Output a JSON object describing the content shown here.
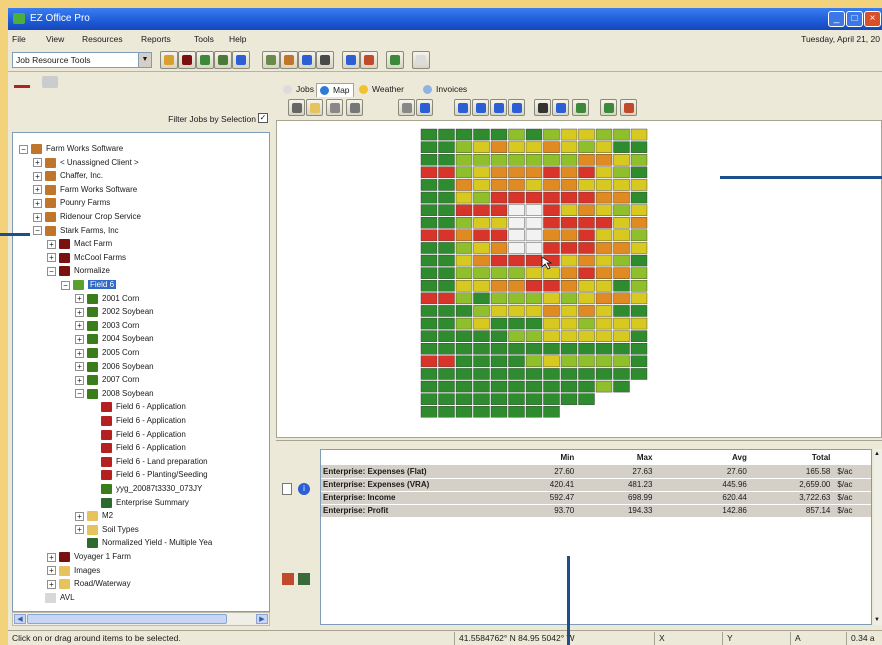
{
  "window": {
    "title": "EZ Office Pro"
  },
  "menu": {
    "items": [
      "File",
      "View",
      "Resources",
      "Reports",
      "Tools",
      "Help"
    ],
    "date": "Tuesday, April 21, 20"
  },
  "toolbar": {
    "combo_value": "Job Resource Tools"
  },
  "left": {
    "filter_label": "Filter Jobs by Selection",
    "filter_checked": "✓",
    "tree": [
      {
        "label": "Farm Works Software",
        "depth": 0,
        "pm": "−",
        "icon": "#c0762a"
      },
      {
        "label": "< Unassigned Client >",
        "depth": 1,
        "pm": "+",
        "icon": "#c0762a"
      },
      {
        "label": "Chaffer, Inc.",
        "depth": 1,
        "pm": "+",
        "icon": "#c0762a"
      },
      {
        "label": "Farm Works Software",
        "depth": 1,
        "pm": "+",
        "icon": "#c0762a"
      },
      {
        "label": "Pounry Farms",
        "depth": 1,
        "pm": "+",
        "icon": "#c0762a"
      },
      {
        "label": "Ridenour Crop Service",
        "depth": 1,
        "pm": "+",
        "icon": "#c0762a"
      },
      {
        "label": "Stark Farms, Inc",
        "depth": 1,
        "pm": "−",
        "icon": "#c0762a"
      },
      {
        "label": "Mact Farm",
        "depth": 2,
        "pm": "+",
        "icon": "#7a1010"
      },
      {
        "label": "McCool Farms",
        "depth": 2,
        "pm": "+",
        "icon": "#7a1010"
      },
      {
        "label": "Normalize",
        "depth": 2,
        "pm": "−",
        "icon": "#7a1010"
      },
      {
        "label": "Field 6",
        "depth": 3,
        "pm": "−",
        "icon": "#5ba02e",
        "selected": true
      },
      {
        "label": "2001 Corn",
        "depth": 4,
        "pm": "+",
        "icon": "#3a7d1c"
      },
      {
        "label": "2002 Soybean",
        "depth": 4,
        "pm": "+",
        "icon": "#3a7d1c"
      },
      {
        "label": "2003 Corn",
        "depth": 4,
        "pm": "+",
        "icon": "#3a7d1c"
      },
      {
        "label": "2004 Soybean",
        "depth": 4,
        "pm": "+",
        "icon": "#3a7d1c"
      },
      {
        "label": "2005 Corn",
        "depth": 4,
        "pm": "+",
        "icon": "#3a7d1c"
      },
      {
        "label": "2006 Soybean",
        "depth": 4,
        "pm": "+",
        "icon": "#3a7d1c"
      },
      {
        "label": "2007 Corn",
        "depth": 4,
        "pm": "+",
        "icon": "#3a7d1c"
      },
      {
        "label": "2008 Soybean",
        "depth": 4,
        "pm": "−",
        "icon": "#3a7d1c"
      },
      {
        "label": "Field 6 - Application",
        "depth": 5,
        "pm": "",
        "icon": "#b52020"
      },
      {
        "label": "Field 6 - Application",
        "depth": 5,
        "pm": "",
        "icon": "#b52020"
      },
      {
        "label": "Field 6 - Application",
        "depth": 5,
        "pm": "",
        "icon": "#b52020"
      },
      {
        "label": "Field 6 - Application",
        "depth": 5,
        "pm": "",
        "icon": "#b52020"
      },
      {
        "label": "Field 6 - Land preparation",
        "depth": 5,
        "pm": "",
        "icon": "#b52020"
      },
      {
        "label": "Field 6 - Planting/Seeding",
        "depth": 5,
        "pm": "",
        "icon": "#b52020"
      },
      {
        "label": "yyg_20087t3330_073JY",
        "depth": 5,
        "pm": "",
        "icon": "#3a7d1c"
      },
      {
        "label": "Enterprise Summary",
        "depth": 5,
        "pm": "",
        "icon": "#2d6a2d"
      },
      {
        "label": "M2",
        "depth": 4,
        "pm": "+",
        "icon": "#e6c35c"
      },
      {
        "label": "Soil Types",
        "depth": 4,
        "pm": "+",
        "icon": "#e6c35c"
      },
      {
        "label": "Normalized Yield - Multiple Yea",
        "depth": 4,
        "pm": "",
        "icon": "#2d6a2d"
      },
      {
        "label": "Voyager 1 Farm",
        "depth": 2,
        "pm": "+",
        "icon": "#7a1010"
      },
      {
        "label": "Images",
        "depth": 2,
        "pm": "+",
        "icon": "#e6c35c"
      },
      {
        "label": "Road/Waterway",
        "depth": 2,
        "pm": "+",
        "icon": "#e6c35c"
      },
      {
        "label": "AVL",
        "depth": 1,
        "pm": "",
        "icon": "#d8d8d8"
      }
    ]
  },
  "tabs": [
    {
      "label": "Jobs",
      "icon": "#dcdcdc"
    },
    {
      "label": "Map",
      "icon": "#2c7bd6"
    },
    {
      "label": "Weather",
      "icon": "#f2c12e"
    },
    {
      "label": "Invoices",
      "icon": "#8fb3e0"
    }
  ],
  "map": {
    "colors": {
      "high": "#2e8b2e",
      "midhigh": "#8fbf2a",
      "mid": "#d7c920",
      "midlow": "#e08a22",
      "low": "#d9342a",
      "void": "#f2f2f2"
    }
  },
  "summary": {
    "columns": [
      "",
      "Min",
      "Max",
      "Avg",
      "Total",
      ""
    ],
    "rows": [
      [
        "Enterprise: Expenses (Flat)",
        "27.60",
        "27.63",
        "27.60",
        "165.58",
        "$/ac"
      ],
      [
        "Enterprise: Expenses (VRA)",
        "420.41",
        "481.23",
        "445.96",
        "2,659.00",
        "$/ac"
      ],
      [
        "Enterprise: Income",
        "592.47",
        "698.99",
        "620.44",
        "3,722.63",
        "$/ac"
      ],
      [
        "Enterprise: Profit",
        "93.70",
        "194.33",
        "142.86",
        "857.14",
        "$/ac"
      ]
    ]
  },
  "status": {
    "message": "Click on or drag around items to be selected.",
    "coords": "41.5584762° N  84.95 5042° W",
    "x_label": "X",
    "y_label": "Y",
    "a_label": "A",
    "scale": "0.34 a"
  }
}
